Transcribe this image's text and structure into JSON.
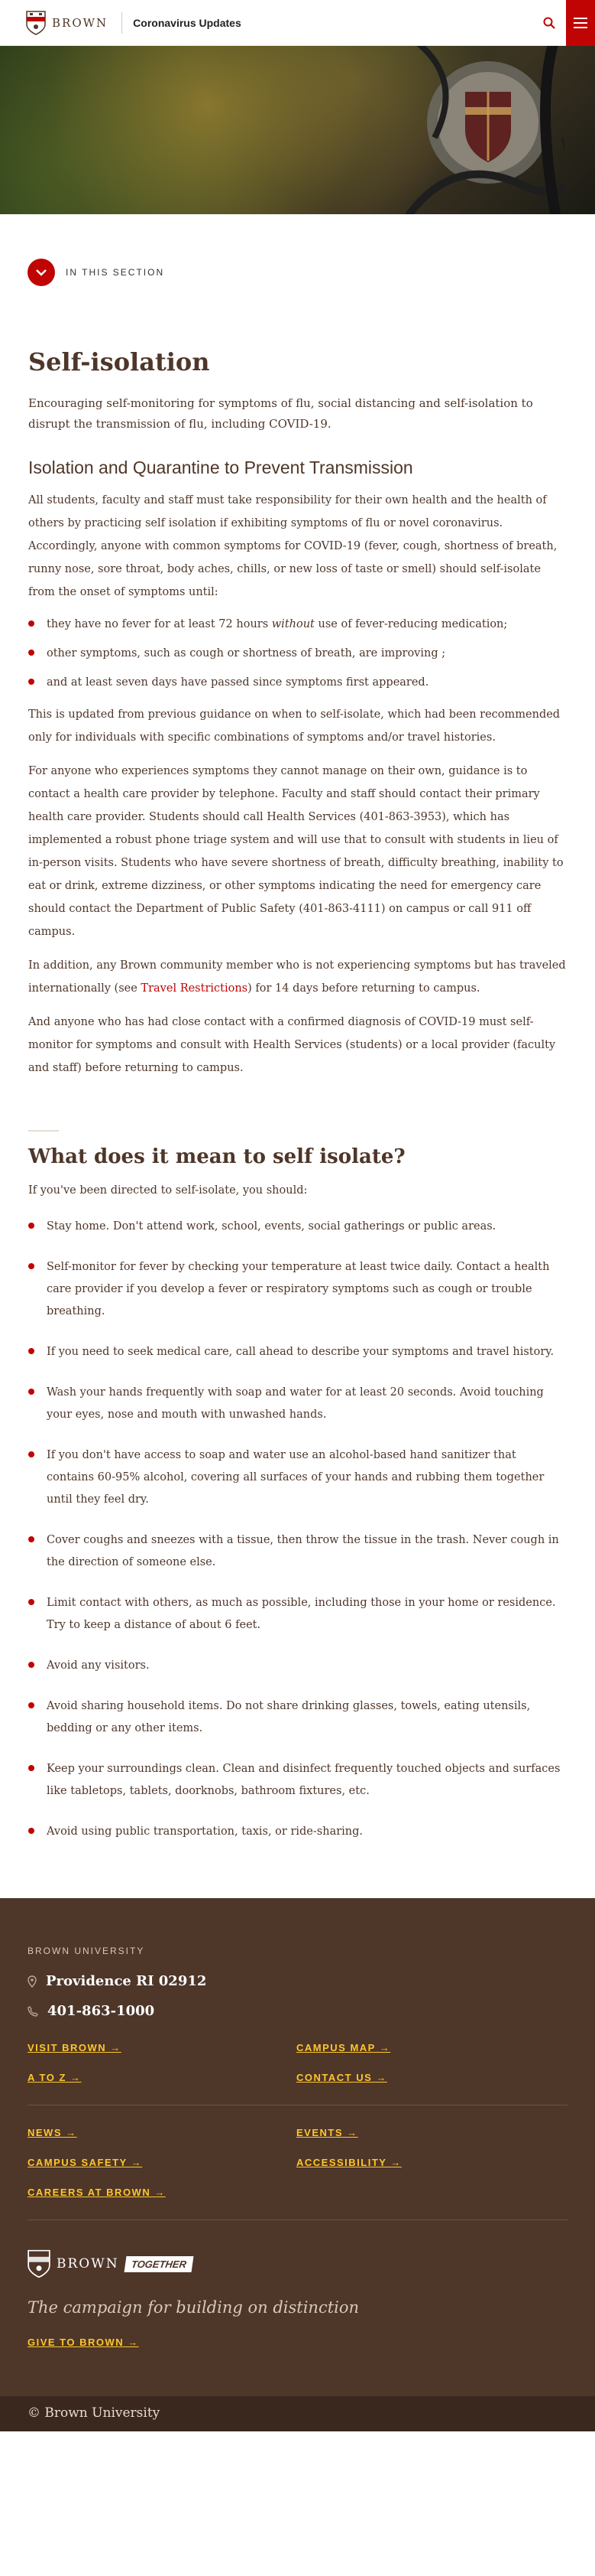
{
  "header": {
    "brand": "BROWN",
    "site_title": "Coronavirus Updates",
    "search_icon": "search-icon",
    "menu_icon": "hamburger-menu-icon"
  },
  "section_nav": {
    "label": "IN THIS SECTION",
    "icon": "chevron-down-icon"
  },
  "page": {
    "title": "Self-isolation",
    "intro": "Encouraging self-monitoring for symptoms of flu, social distancing and self-isolation to disrupt the transmission of flu, including COVID-19.",
    "section1_heading": "Isolation and Quarantine to Prevent Transmission",
    "section1_p1": "All students, faculty and staff must take responsibility for their own health and the health of others by practicing self isolation if exhibiting symptoms of flu or novel coronavirus. Accordingly, anyone with common symptoms for COVID-19 (fever, cough, shortness of breath, runny nose, sore throat, body aches, chills, or new loss of taste or smell) should self-isolate from the onset of symptoms until:",
    "until_items": {
      "item1_pre": "they have no fever for at least 72 hours ",
      "item1_em": "without",
      "item1_post": " use of fever-reducing medication;",
      "item2": "other symptoms, such as cough or shortness of breath, are improving ;",
      "item3": "and at least seven days have passed since symptoms first appeared."
    },
    "section1_p2": "This is updated from previous guidance on when to self-isolate, which had been recommended only for individuals with specific combinations of symptoms and/or travel histories.",
    "section1_p3": "For anyone who experiences symptoms they cannot manage on their own, guidance is to contact a health care provider by telephone. Faculty and staff should contact their primary health care provider. Students should call Health Services (401-863-3953), which has implemented a robust phone triage system and will use that to consult with students in lieu of in-person visits. Students who have severe shortness of breath, difficulty breathing, inability to eat or drink, extreme dizziness, or other symptoms indicating the need for emergency care should contact the Department of Public Safety (401-863-4111) on campus or call 911 off campus.",
    "section1_p4_pre": "In addition, any Brown community member who is not experiencing symptoms but has traveled internationally (see ",
    "section1_p4_link": "Travel Restrictions",
    "section1_p4_post": ") for 14 days before returning to campus.",
    "section1_p5": "And anyone who has had close contact with a confirmed diagnosis of COVID-19 must self-monitor for symptoms and consult with Health Services (students) or a local provider (faculty and staff) before returning to campus.",
    "section2_heading": "What does it mean to self isolate?",
    "section2_lead": "If you've been directed to self-isolate, you should:",
    "section2_items": [
      "Stay home. Don't attend work, school, events, social gatherings or public areas.",
      "Self-monitor for fever by checking your temperature at least twice daily. Contact a health care provider if you develop a fever or respiratory symptoms such as cough or trouble breathing.",
      "If you need to seek medical care, call ahead to describe your symptoms and travel history.",
      "Wash your hands frequently with soap and water for at least 20 seconds. Avoid touching your eyes, nose and mouth with unwashed hands.",
      "If you don't have access to soap and water use an alcohol-based hand sanitizer that contains 60-95% alcohol, covering all surfaces of your hands and rubbing them together until they feel dry.",
      "Cover coughs and sneezes with a tissue, then throw the tissue in the trash. Never cough in the direction of someone else.",
      "Limit contact with others, as much as possible, including those in your home or residence. Try to keep a distance of about 6 feet.",
      "Avoid any visitors.",
      "Avoid sharing household items. Do not share drinking glasses, towels, eating utensils, bedding or any other items.",
      "Keep your surroundings clean. Clean and disinfect frequently touched objects and surfaces like tabletops, tablets, doorknobs, bathroom fixtures, etc.",
      "Avoid using public transportation, taxis, or ride-sharing."
    ]
  },
  "footer": {
    "label": "BROWN UNIVERSITY",
    "address": "Providence RI 02912",
    "phone": "401-863-1000",
    "links_row1": [
      "VISIT BROWN →",
      "CAMPUS MAP →",
      "A TO Z →",
      "CONTACT US →"
    ],
    "links_row2": [
      "NEWS →",
      "EVENTS →",
      "CAMPUS SAFETY →",
      "ACCESSIBILITY →",
      "CAREERS AT BROWN →"
    ],
    "together_brand": "BROWN",
    "together_tag": "TOGETHER",
    "campaign": "The campaign for building on distinction",
    "give_link": "GIVE TO BROWN →",
    "copyright": "© Brown University"
  },
  "colors": {
    "brand_red": "#c00404",
    "brand_brown": "#4e3629",
    "gold": "#ffc72c"
  }
}
